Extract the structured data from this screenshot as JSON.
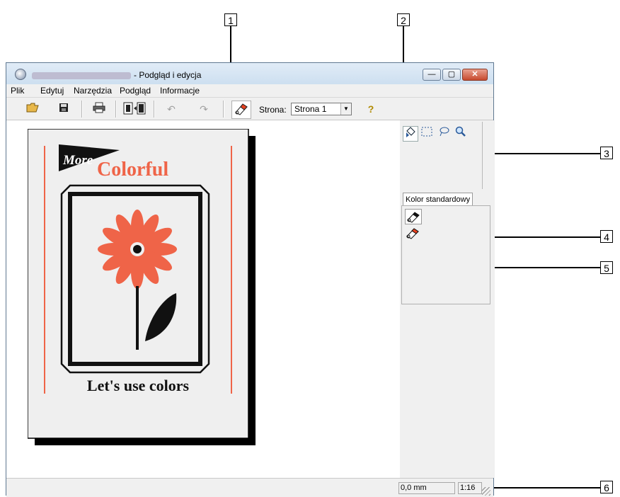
{
  "window": {
    "title_suffix": "- Podgląd i edycja",
    "minimize_symbol": "—",
    "maximize_symbol": "▢",
    "close_symbol": "✕"
  },
  "menu": [
    "Plik",
    "Edytuj",
    "Narzędzia",
    "Podgląd",
    "Informacje"
  ],
  "toolbar": {
    "open_icon": "📂",
    "save_icon": "💾",
    "print_icon": "🖶",
    "undo_symbol": "↶",
    "redo_symbol": "↷",
    "help_symbol": "?",
    "page_label": "Strona:",
    "page_value": "Strona 1",
    "dropdown_arrow": "▼"
  },
  "document": {
    "pennant_text": "More",
    "heading": "Colorful",
    "caption": "Let's use colors"
  },
  "right_panel": {
    "tab_label": "Kolor standardowy"
  },
  "status": {
    "position": "0,0 mm",
    "zoom": "1:16"
  },
  "callouts": [
    "1",
    "2",
    "3",
    "4",
    "5",
    "6"
  ],
  "colors": {
    "accent": "#ef6448",
    "ink": "#111111"
  }
}
